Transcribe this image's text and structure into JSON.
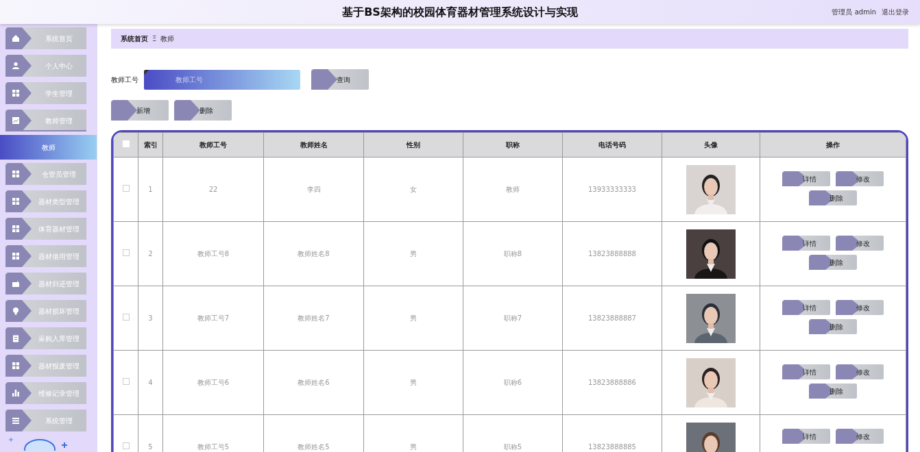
{
  "header": {
    "title": "基于BS架构的校园体育器材管理系统设计与实现",
    "user": "管理员 admin",
    "logout": "退出登录"
  },
  "sidebar": {
    "items": [
      {
        "label": "系统首页",
        "selected": false,
        "expanded": false
      },
      {
        "label": "个人中心",
        "selected": false,
        "expanded": false
      },
      {
        "label": "学生管理",
        "selected": false,
        "expanded": false
      },
      {
        "label": "教师管理",
        "selected": false,
        "expanded": true,
        "children": [
          {
            "label": "教师",
            "selected": true
          }
        ]
      },
      {
        "label": "仓管员管理",
        "selected": false,
        "expanded": false
      },
      {
        "label": "器材类型管理",
        "selected": false,
        "expanded": false
      },
      {
        "label": "体育器材管理",
        "selected": false,
        "expanded": false
      },
      {
        "label": "器材借用管理",
        "selected": false,
        "expanded": false
      },
      {
        "label": "器材归还管理",
        "selected": false,
        "expanded": false
      },
      {
        "label": "器材损坏管理",
        "selected": false,
        "expanded": false
      },
      {
        "label": "采购入库管理",
        "selected": false,
        "expanded": false
      },
      {
        "label": "器材报废管理",
        "selected": false,
        "expanded": false
      },
      {
        "label": "维修记录管理",
        "selected": false,
        "expanded": false
      },
      {
        "label": "系统管理",
        "selected": false,
        "expanded": false
      }
    ]
  },
  "breadcrumb": {
    "items": [
      "系统首页",
      "教师"
    ],
    "separator": "Ξ"
  },
  "search": {
    "label": "教师工号",
    "placeholder": "教师工号",
    "button": "查询"
  },
  "actions": [
    "新增",
    "删除"
  ],
  "table": {
    "select_all_checked": false,
    "columns": [
      "索引",
      "教师工号",
      "教师姓名",
      "性别",
      "职称",
      "电话号码",
      "头像",
      "操作"
    ],
    "rows": [
      {
        "checked": false,
        "cells": [
          "1",
          "22",
          "李四",
          "女",
          "教师",
          "13933333333"
        ],
        "avatar": {
          "kind": "picture"
        },
        "actions": [
          "详情",
          "修改",
          "删除"
        ]
      },
      {
        "checked": false,
        "cells": [
          "2",
          "教师工号8",
          "教师姓名8",
          "男",
          "职称8",
          "13823888888"
        ],
        "avatar": {
          "kind": "picture"
        },
        "actions": [
          "详情",
          "修改",
          "删除"
        ]
      },
      {
        "checked": false,
        "cells": [
          "3",
          "教师工号7",
          "教师姓名7",
          "男",
          "职称7",
          "13823888887"
        ],
        "avatar": {
          "kind": "picture"
        },
        "actions": [
          "详情",
          "修改",
          "删除"
        ]
      },
      {
        "checked": false,
        "cells": [
          "4",
          "教师工号6",
          "教师姓名6",
          "男",
          "职称6",
          "13823888886"
        ],
        "avatar": {
          "kind": "picture"
        },
        "actions": [
          "详情",
          "修改",
          "删除"
        ]
      },
      {
        "checked": false,
        "cells": [
          "5",
          "教师工号5",
          "教师姓名5",
          "男",
          "职称5",
          "13823888885"
        ],
        "avatar": {
          "kind": "picture"
        },
        "actions": [
          "详情",
          "修改"
        ]
      }
    ]
  }
}
